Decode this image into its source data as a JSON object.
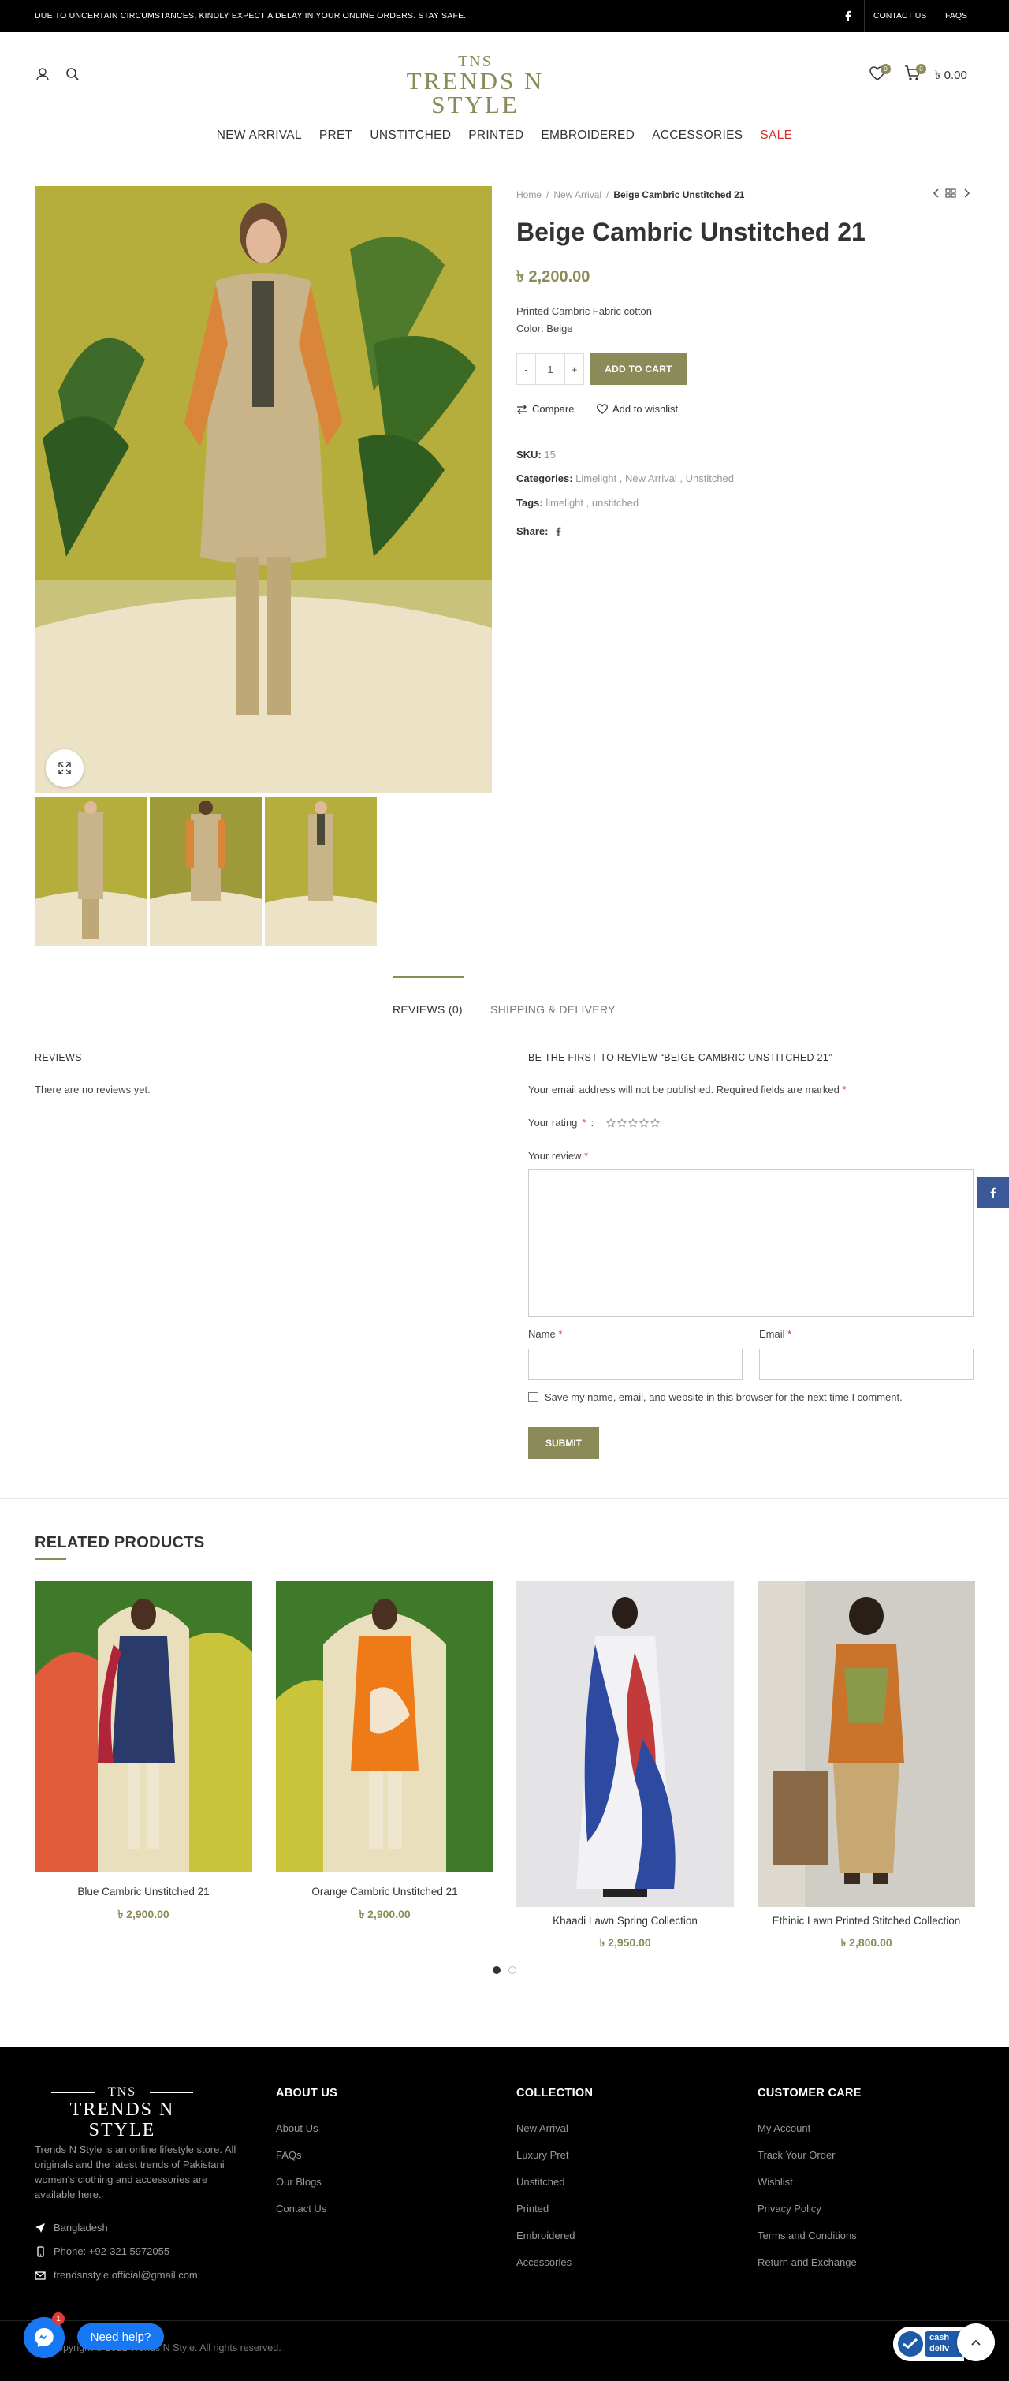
{
  "topbar": {
    "notice": "DUE TO UNCERTAIN CIRCUMSTANCES, KINDLY EXPECT A DELAY IN YOUR ONLINE ORDERS. STAY SAFE.",
    "contact": "CONTACT US",
    "faqs": "FAQS"
  },
  "header": {
    "logo_top": "TNS",
    "logo_main": "TRENDS N STYLE",
    "wishlist_count": "0",
    "cart_count": "0",
    "cart_total": "৳ 0.00"
  },
  "nav": [
    "NEW ARRIVAL",
    "PRET",
    "UNSTITCHED",
    "PRINTED",
    "EMBROIDERED",
    "ACCESSORIES",
    "SALE"
  ],
  "breadcrumb": {
    "home": "Home",
    "sep1": "/",
    "cat": "New Arrival",
    "sep2": "/",
    "current": "Beige Cambric Unstitched 21"
  },
  "product": {
    "title": "Beige Cambric Unstitched 21",
    "price": "৳  2,200.00",
    "desc_line1": "Printed Cambric Fabric cotton",
    "desc_line2": "Color: Beige",
    "qty_minus": "-",
    "qty": "1",
    "qty_plus": "+",
    "add_to_cart": "ADD TO CART",
    "compare": "Compare",
    "wishlist": "Add to wishlist",
    "sku_label": "SKU:",
    "sku": "15",
    "categories_label": "Categories:",
    "categories": "Limelight , New Arrival , Unstitched",
    "tags_label": "Tags:",
    "tags": "limelight , unstitched",
    "share_label": "Share:"
  },
  "tabs": {
    "reviews": "REVIEWS (0)",
    "shipping": "SHIPPING & DELIVERY"
  },
  "reviews": {
    "heading": "REVIEWS",
    "none": "There are no reviews yet.",
    "form_heading": "BE THE FIRST TO REVIEW “BEIGE CAMBRIC UNSTITCHED 21”",
    "notice": "Your email address will not be published. Required fields are marked",
    "star": "*",
    "rating_label": "Your rating",
    "review_label": "Your review",
    "name_label": "Name",
    "email_label": "Email",
    "save_info": "Save my name, email, and website in this browser for the next time I comment.",
    "submit": "SUBMIT"
  },
  "related": {
    "title": "RELATED PRODUCTS",
    "products": [
      {
        "name": "Blue Cambric Unstitched 21",
        "price": "৳  2,900.00"
      },
      {
        "name": "Orange Cambric Unstitched 21",
        "price": "৳  2,900.00"
      },
      {
        "name": "Khaadi Lawn Spring Collection",
        "price": "৳  2,950.00"
      },
      {
        "name": "Ethinic Lawn Printed Stitched Collection",
        "price": "৳  2,800.00"
      }
    ]
  },
  "footer": {
    "logo_top": "TNS",
    "logo_main": "TRENDS N STYLE",
    "about_text": "Trends N Style is an online lifestyle store. All originals and the latest trends of Pakistani women's clothing and accessories are available here.",
    "location": "Bangladesh",
    "phone": "Phone: +92-321 5972055",
    "email": "trendsnstyle.official@gmail.com",
    "about_heading": "ABOUT US",
    "about_links": [
      "About Us",
      "FAQs",
      "Our Blogs",
      "Contact Us"
    ],
    "collection_heading": "COLLECTION",
    "collection_links": [
      "New Arrival",
      "Luxury Pret",
      "Unstitched",
      "Printed",
      "Embroidered",
      "Accessories"
    ],
    "care_heading": "CUSTOMER CARE",
    "care_links": [
      "My Account",
      "Track Your Order",
      "Wishlist",
      "Privacy Policy",
      "Terms and Conditions",
      "Return and Exchange"
    ],
    "copyright": "Copyright © 2021 Trends N Style. All rights reserved."
  },
  "widgets": {
    "messenger_badge": "1",
    "need_help": "Need help?",
    "cod_line1": "cash",
    "cod_line2": "deliv"
  },
  "colors": {
    "accent": "#8b8b5a",
    "sale": "#d32f2f",
    "messenger": "#1877f2",
    "facebook": "#3b5998"
  }
}
